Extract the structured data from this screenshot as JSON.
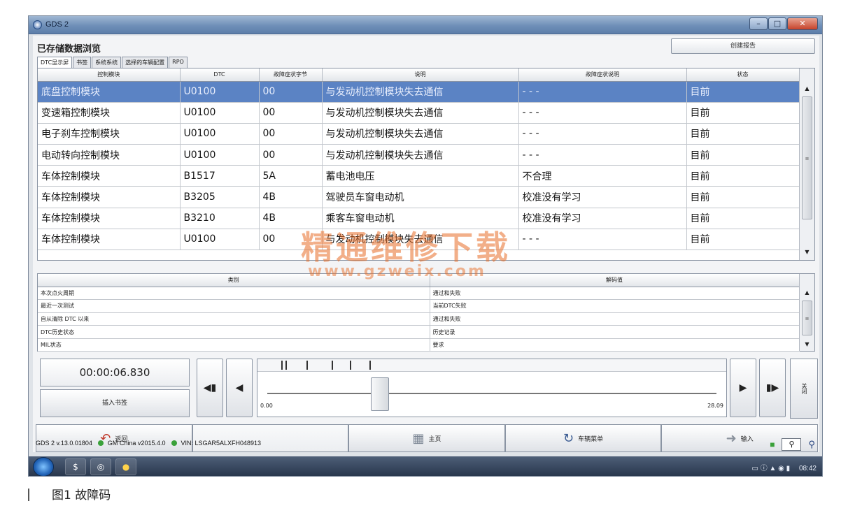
{
  "window": {
    "title": "GDS 2",
    "min": "–",
    "max": "□",
    "close": "✕"
  },
  "page": {
    "title": "已存储数据浏览",
    "report_button": "创建报告"
  },
  "tabs": [
    "DTC显示屏",
    "书签",
    "系统系统",
    "选择的车辆配置",
    "RPO"
  ],
  "dtc_table": {
    "headers": [
      "控制模块",
      "DTC",
      "故障症状字节",
      "说明",
      "故障症状说明",
      "状态"
    ],
    "rows": [
      [
        "底盘控制模块",
        "U0100",
        "00",
        "与发动机控制模块失去通信",
        "- - -",
        "目前"
      ],
      [
        "变速箱控制模块",
        "U0100",
        "00",
        "与发动机控制模块失去通信",
        "- - -",
        "目前"
      ],
      [
        "电子刹车控制模块",
        "U0100",
        "00",
        "与发动机控制模块失去通信",
        "- - -",
        "目前"
      ],
      [
        "电动转向控制模块",
        "U0100",
        "00",
        "与发动机控制模块失去通信",
        "- - -",
        "目前"
      ],
      [
        "车体控制模块",
        "B1517",
        "5A",
        "蓄电池电压",
        "不合理",
        "目前"
      ],
      [
        "车体控制模块",
        "B3205",
        "4B",
        "驾驶员车窗电动机",
        "校准没有学习",
        "目前"
      ],
      [
        "车体控制模块",
        "B3210",
        "4B",
        "乘客车窗电动机",
        "校准没有学习",
        "目前"
      ],
      [
        "车体控制模块",
        "U0100",
        "00",
        "与发动机控制模块失去通信",
        "- - -",
        "目前"
      ]
    ]
  },
  "status_table": {
    "headers": [
      "类别",
      "解码值"
    ],
    "rows": [
      [
        "本次点火周期",
        "通过和失败"
      ],
      [
        "最近一次测试",
        "当前DTC失败"
      ],
      [
        "自从清除 DTC 以来",
        "通过和失败"
      ],
      [
        "DTC历史状态",
        "历史记录"
      ],
      [
        "MIL状态",
        "要求"
      ]
    ]
  },
  "playback": {
    "timer": "00:00:06.830",
    "bookmark_button": "插入书签",
    "range_min": "0.00",
    "range_max": "28.09",
    "position_fraction": 0.24,
    "close_button": "关闭"
  },
  "nav": {
    "back": "返回",
    "home": "主页",
    "vehicle_menu": "车辆菜单",
    "input": "输入"
  },
  "statusbar": {
    "version": "GDS 2 v.13.0.01804",
    "gm": "GM China v2015.4.0",
    "vin": "VIN: LSGAR5ALXFH048913"
  },
  "taskbar": {
    "clock": "08:42"
  },
  "caption": "图1  故障码",
  "watermark": {
    "text": "精通维修下载",
    "url": "www.gzweix.com"
  }
}
